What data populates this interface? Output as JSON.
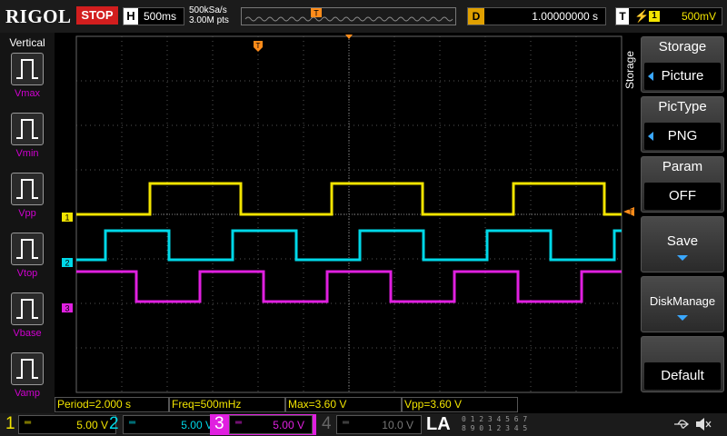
{
  "top_bar": {
    "brand": "RIGOL",
    "run_status": "STOP",
    "horizontal_label": "H",
    "timebase": "500ms",
    "sample_rate": "500kSa/s",
    "memory_depth": "3.00M pts",
    "trigger_pos_marker": "T",
    "delay_label": "D",
    "delay_value": "1.00000000 s",
    "trigger_label": "T",
    "trigger_slope_icon": "rising-edge-icon",
    "trigger_source": "1",
    "trigger_level": "500mV"
  },
  "left_panel": {
    "title": "Vertical",
    "items": [
      {
        "label": "Vmax"
      },
      {
        "label": "Vmin"
      },
      {
        "label": "Vpp"
      },
      {
        "label": "Vtop"
      },
      {
        "label": "Vbase"
      },
      {
        "label": "Vamp"
      }
    ]
  },
  "right_menu": {
    "menu_title": "Storage",
    "vertical_label": "Storage",
    "softkeys": [
      {
        "title": "Storage",
        "value": "Picture"
      },
      {
        "title": "PicType",
        "value": "PNG"
      },
      {
        "title": "Param",
        "value": "OFF"
      },
      {
        "title": "Save"
      },
      {
        "title": "DiskManage"
      },
      {
        "title": "Default"
      }
    ]
  },
  "waveform_markers": {
    "ch1": "1",
    "ch2": "2",
    "ch3": "3",
    "trigger_level": "T",
    "trigger_time": "T"
  },
  "results": {
    "period": "Period=2.000 s",
    "freq": "Freq=500mHz",
    "max": "Max=3.60 V",
    "vpp": "Vpp=3.60 V"
  },
  "channels": [
    {
      "num": "1",
      "scale": "5.00 V",
      "color": "#f2e400",
      "coupling": "dc-coupling-icon"
    },
    {
      "num": "2",
      "scale": "5.00 V",
      "color": "#00d8e8",
      "coupling": "dc-coupling-icon"
    },
    {
      "num": "3",
      "scale": "5.00 V",
      "color": "#e020e0",
      "coupling": "dc-coupling-icon"
    },
    {
      "num": "4",
      "scale": "10.0 V",
      "color": "#555555",
      "coupling": "dc-coupling-icon"
    }
  ],
  "logic_analyzer": {
    "label": "LA",
    "bits_top": "0 1 2 3  4 5 6 7",
    "bits_bottom": "8 9 0 1  2 3 4 5"
  },
  "waveforms": {
    "ch1": {
      "color": "#f2e400",
      "period_s": 2.0,
      "high_v": 3.6,
      "low_v": 0
    },
    "ch2": {
      "color": "#00d8e8",
      "period_s": 1.4,
      "high_v": 3.6,
      "low_v": 0
    },
    "ch3": {
      "color": "#e020e0",
      "period_s": 1.4,
      "high_v": 3.6,
      "low_v": 0
    }
  },
  "colors": {
    "ch1": "#f2e400",
    "ch2": "#00d8e8",
    "ch3": "#e020e0",
    "trigger": "#ff8c1a",
    "stop": "#d21e1e",
    "arrow": "#3aa8ff"
  }
}
